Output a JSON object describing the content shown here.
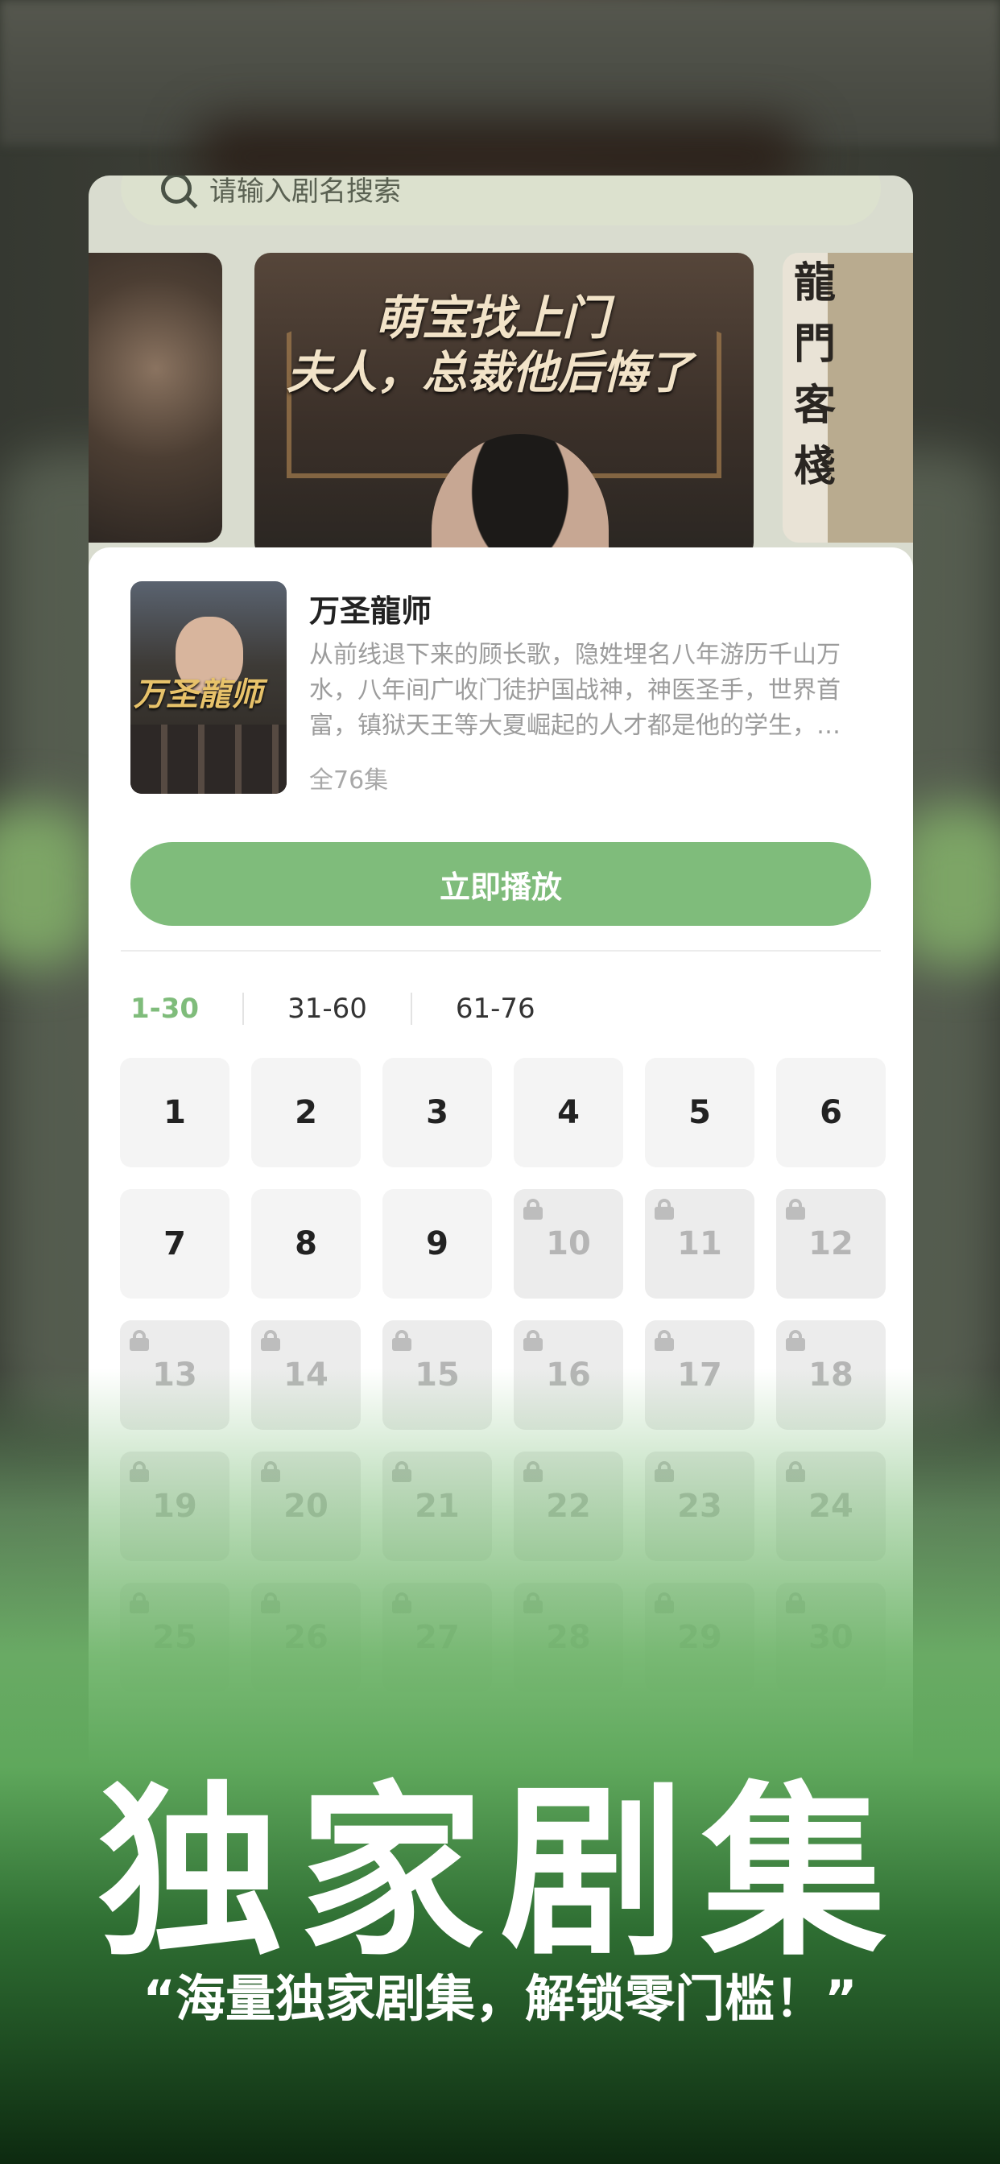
{
  "search": {
    "placeholder": "请输入剧名搜索"
  },
  "banners": {
    "center_title_line1": "萌宝找上门",
    "center_title_line2": "夫人，总裁他后悔了",
    "right_vertical_text": "龍門客棧"
  },
  "drama": {
    "poster_title": "万圣龍师",
    "title": "万圣龍师",
    "description": "从前线退下来的顾长歌，隐姓埋名八年游历千山万水，八年间广收门徒护国战神，神医圣手，世界首富，镇狱天王等大夏崛起的人才都是他的学生，…",
    "episode_count": "全76集"
  },
  "play_button": "立即播放",
  "tabs": [
    "1-30",
    "31-60",
    "61-76"
  ],
  "active_tab": "1-30",
  "episodes": [
    {
      "n": "1",
      "locked": false
    },
    {
      "n": "2",
      "locked": false
    },
    {
      "n": "3",
      "locked": false
    },
    {
      "n": "4",
      "locked": false
    },
    {
      "n": "5",
      "locked": false
    },
    {
      "n": "6",
      "locked": false
    },
    {
      "n": "7",
      "locked": false
    },
    {
      "n": "8",
      "locked": false
    },
    {
      "n": "9",
      "locked": false
    },
    {
      "n": "10",
      "locked": true
    },
    {
      "n": "11",
      "locked": true
    },
    {
      "n": "12",
      "locked": true
    },
    {
      "n": "13",
      "locked": true
    },
    {
      "n": "14",
      "locked": true
    },
    {
      "n": "15",
      "locked": true
    },
    {
      "n": "16",
      "locked": true
    },
    {
      "n": "17",
      "locked": true
    },
    {
      "n": "18",
      "locked": true
    },
    {
      "n": "19",
      "locked": true
    },
    {
      "n": "20",
      "locked": true
    },
    {
      "n": "21",
      "locked": true
    },
    {
      "n": "22",
      "locked": true
    },
    {
      "n": "23",
      "locked": true
    },
    {
      "n": "24",
      "locked": true
    },
    {
      "n": "25",
      "locked": true
    },
    {
      "n": "26",
      "locked": true
    },
    {
      "n": "27",
      "locked": true
    },
    {
      "n": "28",
      "locked": true
    },
    {
      "n": "29",
      "locked": true
    },
    {
      "n": "30",
      "locked": true
    }
  ],
  "promo": {
    "title": "独家剧集",
    "subtitle": "“海量独家剧集，解锁零门槛！”"
  },
  "colors": {
    "accent": "#7fbc7b",
    "locked_text": "#b5b5b5",
    "promo_green": "#5fa85c"
  }
}
